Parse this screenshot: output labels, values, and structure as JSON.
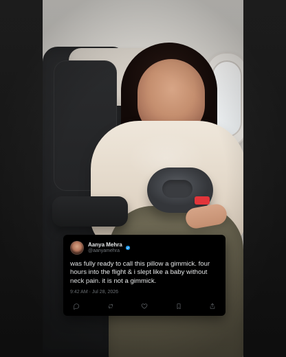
{
  "tweet": {
    "display_name": "Aanya Mehra",
    "handle": "@aanyamehra",
    "text": "was fully ready to call this pillow a gimmick. four hours into the flight & i slept like a baby without neck pain. it is not a gimmick.",
    "timestamp": "9:42 AM · Jul 28, 2026",
    "icons": {
      "verified": "verified-badge-icon",
      "reply": "reply-icon",
      "repost": "repost-icon",
      "like": "heart-icon",
      "bookmark": "bookmark-icon",
      "share": "share-icon"
    }
  },
  "scene": {
    "pillow_tag_color": "#e2353a"
  }
}
